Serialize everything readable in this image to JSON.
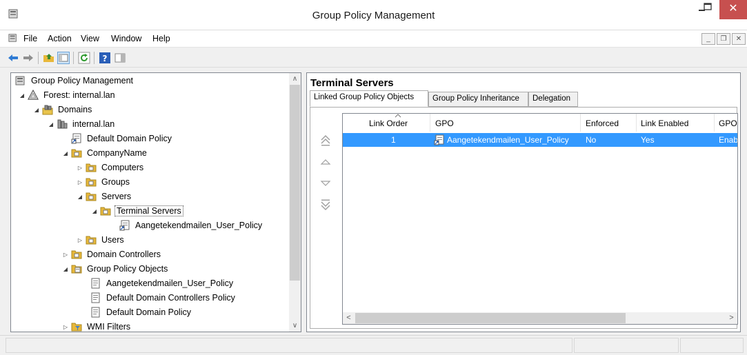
{
  "window": {
    "title": "Group Policy Management",
    "close_glyph": "✕",
    "colors": {
      "close": "#c7504f",
      "selection": "#3399ff"
    }
  },
  "menu": {
    "items": [
      "File",
      "Action",
      "View",
      "Window",
      "Help"
    ]
  },
  "tree": {
    "root": "Group Policy Management",
    "forest": "Forest: internal.lan",
    "domains": "Domains",
    "domain": "internal.lan",
    "default_domain_policy": "Default Domain Policy",
    "company": "CompanyName",
    "computers": "Computers",
    "groups": "Groups",
    "servers": "Servers",
    "terminal_servers": "Terminal Servers",
    "linked_policy": "Aangetekendmailen_User_Policy",
    "users": "Users",
    "domain_controllers": "Domain Controllers",
    "gpo_container": "Group Policy Objects",
    "gpo_items": [
      "Aangetekendmailen_User_Policy",
      "Default Domain Controllers Policy",
      "Default Domain Policy"
    ],
    "wmi_filters": "WMI Filters"
  },
  "details": {
    "heading": "Terminal Servers",
    "tabs": [
      "Linked Group Policy Objects",
      "Group Policy Inheritance",
      "Delegation"
    ],
    "columns": [
      "Link Order",
      "GPO",
      "Enforced",
      "Link Enabled",
      "GPO"
    ],
    "rows": [
      {
        "link_order": "1",
        "gpo": "Aangetekendmailen_User_Policy",
        "enforced": "No",
        "link_enabled": "Yes",
        "gpo_status": "Enab"
      }
    ]
  }
}
